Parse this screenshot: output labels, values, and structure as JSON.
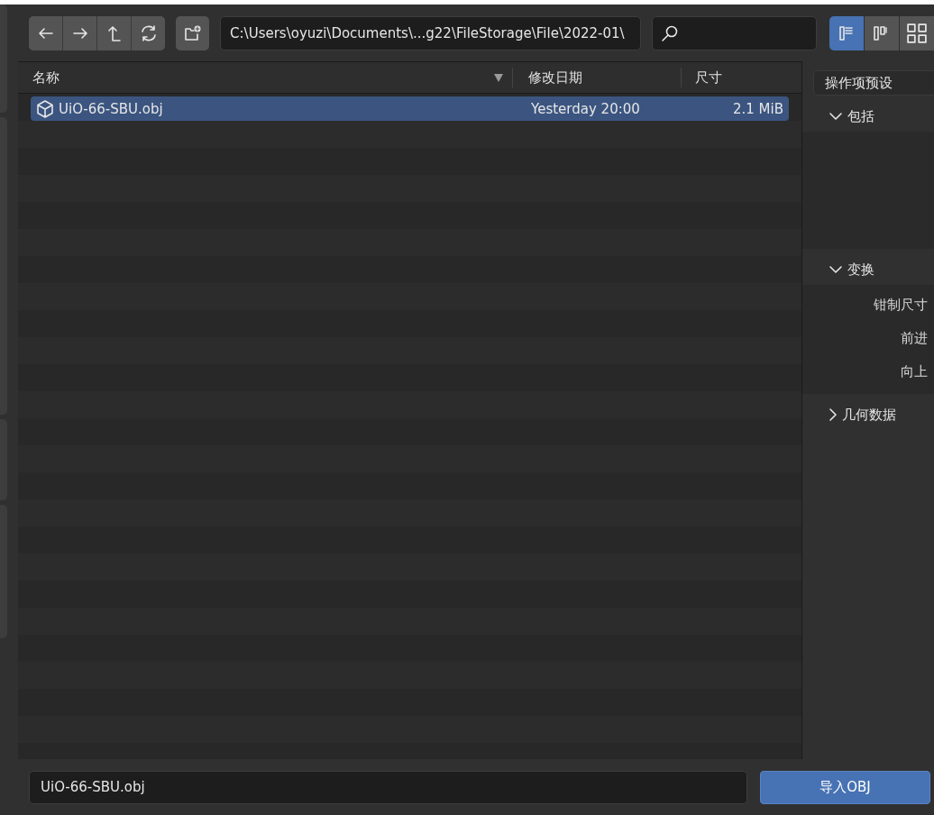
{
  "toolbar": {
    "path": "C:\\Users\\oyuzi\\Documents\\...g22\\FileStorage\\File\\2022-01\\",
    "view_modes": [
      {
        "selected": true
      },
      {
        "selected": false
      },
      {
        "selected": false
      }
    ]
  },
  "file_list": {
    "columns": [
      "名称",
      "修改日期",
      "尺寸"
    ],
    "rows": [
      {
        "name": "UiO-66-SBU.obj",
        "modified": "Yesterday 20:00",
        "size": "2.1 MiB",
        "selected": true
      }
    ]
  },
  "side_panel": {
    "preset": "操作项预设",
    "sections": [
      {
        "title": "包括",
        "expanded": true
      },
      {
        "title": "变换",
        "expanded": true,
        "fields": [
          "钳制尺寸",
          "前进",
          "向上"
        ]
      },
      {
        "title": "几何数据",
        "expanded": false
      }
    ]
  },
  "footer": {
    "filename": "UiO-66-SBU.obj",
    "action": "导入OBJ"
  }
}
